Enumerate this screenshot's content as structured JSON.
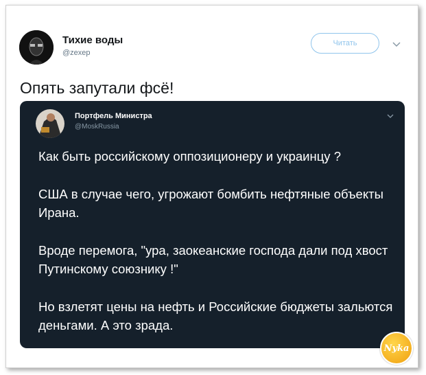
{
  "tweet": {
    "author_name": "Тихие воды",
    "author_handle": "@zexep",
    "follow_label": "Читать",
    "text": "Опять запутали фсё!"
  },
  "quoted_tweet": {
    "author_name": "Портфель Министра",
    "author_handle": "@MoskRussia",
    "paragraphs": [
      "Как быть российскому оппозиционеру и украинцу ?",
      "США в случае чего, угрожают бомбить нефтяные объекты Ирана.",
      "Вроде перемога, \"ура, заокеанские господа дали под хвост Путинскому союзнику !\"",
      "Но взлетят цены на нефть и Российские бюджеты зальются деньгами. А это зрада."
    ]
  },
  "watermark": {
    "text": "Nyka"
  },
  "colors": {
    "accent": "#1da1f2",
    "quote_bg": "#15202b",
    "badge": "#f5b51e"
  },
  "icons": [
    "chevron-down-icon"
  ]
}
